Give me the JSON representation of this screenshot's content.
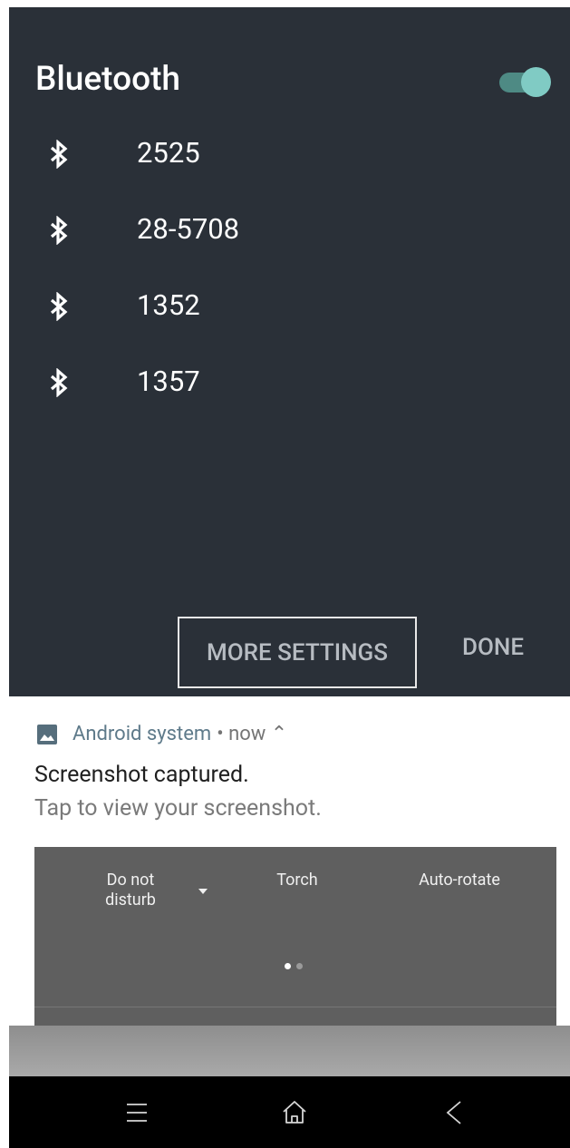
{
  "bluetooth": {
    "title": "Bluetooth",
    "enabled": true,
    "devices": [
      {
        "name": "2525",
        "icon": "bluetooth-icon"
      },
      {
        "name": "28-5708",
        "icon": "bluetooth-icon"
      },
      {
        "name": "1352",
        "icon": "bluetooth-icon"
      },
      {
        "name": "1357",
        "icon": "bluetooth-icon"
      }
    ],
    "more_settings_label": "MORE SETTINGS",
    "done_label": "DONE"
  },
  "notification": {
    "icon": "image-icon",
    "app_name": "Android system",
    "meta": "• now ⌃",
    "title": "Screenshot captured.",
    "text": "Tap to view your screenshot.",
    "preview_tiles": [
      {
        "label_line1": "Do not",
        "label_line2": "disturb"
      },
      {
        "label": "Torch"
      },
      {
        "label": "Auto-rotate"
      }
    ],
    "page_indicator": {
      "pages": 2,
      "active": 1
    }
  },
  "navbar": {
    "buttons": [
      "menu-icon",
      "home-icon",
      "back-icon"
    ]
  },
  "colors": {
    "panel_bg": "#2a3038",
    "toggle_accent": "#80cbc4",
    "nav_bg": "#000000"
  }
}
